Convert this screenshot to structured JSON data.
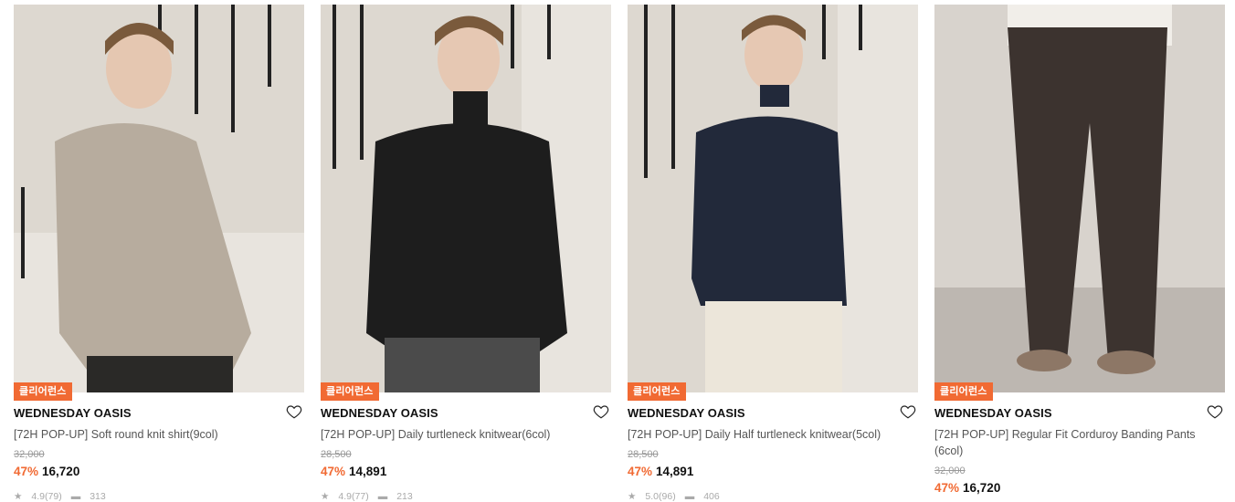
{
  "products": [
    {
      "badge": "클리어런스",
      "brand": "WEDNESDAY OASIS",
      "name": "[72H POP-UP] Soft round knit shirt(9col)",
      "original_price": "32,000",
      "discount": "47%",
      "price": "16,720",
      "rating": "4.9(79)",
      "reviews": "313",
      "colors": {
        "bg": "#dcd6ce",
        "garment": "#b5aa9c",
        "pants": "#2a2927"
      }
    },
    {
      "badge": "클리어런스",
      "brand": "WEDNESDAY OASIS",
      "name": "[72H POP-UP] Daily turtleneck knitwear(6col)",
      "original_price": "28,500",
      "discount": "47%",
      "price": "14,891",
      "rating": "4.9(77)",
      "reviews": "213",
      "colors": {
        "bg": "#dcd6ce",
        "garment": "#1c1c1c",
        "pants": "#4a4a4a"
      }
    },
    {
      "badge": "클리어런스",
      "brand": "WEDNESDAY OASIS",
      "name": "[72H POP-UP] Daily Half turtleneck knitwear(5col)",
      "original_price": "28,500",
      "discount": "47%",
      "price": "14,891",
      "rating": "5.0(96)",
      "reviews": "406",
      "colors": {
        "bg": "#dcd6ce",
        "garment": "#22293a",
        "pants": "#ece6da"
      }
    },
    {
      "badge": "클리어런스",
      "brand": "WEDNESDAY OASIS",
      "name": "[72H POP-UP] Regular Fit Corduroy Banding Pants (6col)",
      "original_price": "32,000",
      "discount": "47%",
      "price": "16,720",
      "rating": "",
      "reviews": "",
      "colors": {
        "bg": "#d6d1cb",
        "garment": "#3d3430",
        "pants": "#3d3430"
      }
    }
  ]
}
